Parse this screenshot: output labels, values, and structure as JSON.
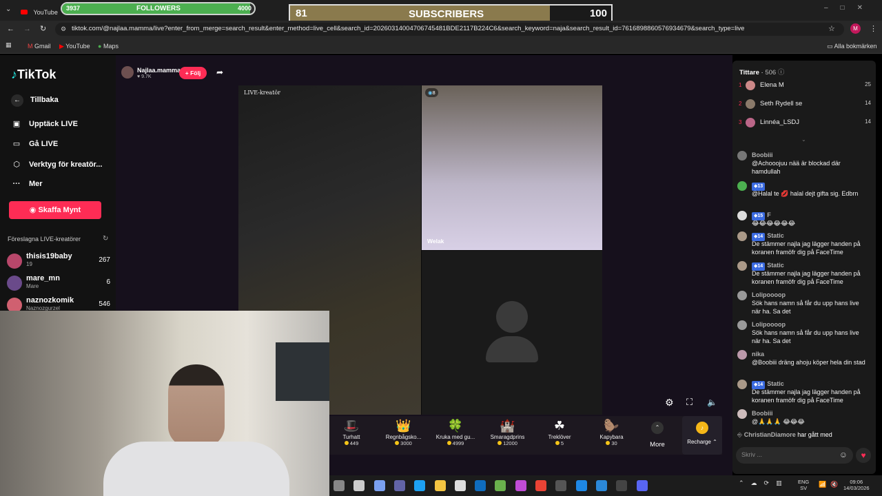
{
  "browser": {
    "tab_title": "YouTube",
    "url": "tiktok.com/@najlaa.mamma/live?enter_from_merge=search_result&enter_method=live_cell&search_id=20260314004706745481BDE2117B224C6&search_keyword=naja&search_result_id=7616898860576934679&search_type=live",
    "bookmarks": [
      "Gmail",
      "YouTube",
      "Maps"
    ],
    "all_bookmarks": "Alla bokmärken",
    "profile_initial": "M"
  },
  "overlay": {
    "followers_label": "FOLLOWERS",
    "followers_current": "3937",
    "followers_goal": "4000",
    "followers_progress": 0.98,
    "subs_label": "SUBSCRIBERS",
    "subs_current": "81",
    "subs_goal": "100",
    "subs_progress": 0.81
  },
  "sidebar": {
    "brand": "TikTok",
    "back": "Tillbaka",
    "items": [
      {
        "label": "Upptäck LIVE",
        "icon": "calendar-icon"
      },
      {
        "label": "Gå LIVE",
        "icon": "camera-icon"
      },
      {
        "label": "Verktyg för kreatör...",
        "icon": "shield-icon"
      },
      {
        "label": "Mer",
        "icon": "more-icon"
      }
    ],
    "coins_button": "Skaffa Mynt",
    "suggested_header": "Föreslagna LIVE-kreatörer",
    "creators": [
      {
        "name": "thisis19baby",
        "sub": "19",
        "count": "267"
      },
      {
        "name": "mare_mn",
        "sub": "Mare",
        "count": "6"
      },
      {
        "name": "naznozkomik",
        "sub": "Naznozgurzel",
        "count": "546"
      }
    ]
  },
  "stream": {
    "host_name": "Najlaa.mamma",
    "host_likes": "9.7K",
    "follow_button": "+ Följ",
    "creator_tag": "LIVE-kreatör",
    "guest_viewers": "8",
    "guest_name": "Welak"
  },
  "gifts": [
    {
      "name": "Turhatt",
      "price": "449",
      "icon": "🎩"
    },
    {
      "name": "Regnbågsko...",
      "price": "3000",
      "icon": "👑"
    },
    {
      "name": "Kruka med gu...",
      "price": "4999",
      "icon": "🍀"
    },
    {
      "name": "Smaragdprins",
      "price": "12000",
      "icon": "🏰"
    },
    {
      "name": "Treklöver",
      "price": "5",
      "icon": "☘"
    },
    {
      "name": "Kapybara",
      "price": "30",
      "icon": "🦫"
    }
  ],
  "gift_more": "Mer",
  "gift_more_big": "More",
  "recharge": "Recharge",
  "viewers": {
    "title": "Tittare",
    "count": "506",
    "list": [
      {
        "rank": "1",
        "name": "Elena M",
        "score": "25"
      },
      {
        "rank": "2",
        "name": "Seth Rydell se",
        "score": "14"
      },
      {
        "rank": "3",
        "name": "Linnéa_LSDJ",
        "score": "14"
      }
    ]
  },
  "chat": [
    {
      "user": "Boobiii",
      "level": "",
      "text": "@Achooojuu nää är blockad där hamdullah"
    },
    {
      "user": "",
      "level": "13",
      "text": "@Halal te 💋 halal dejt gifta sig. Edbrn"
    },
    {
      "user": "F",
      "level": "15",
      "text": "😂😂😂😂😂😂"
    },
    {
      "user": "Static",
      "level": "14",
      "text": "De stämmer najla jag lägger handen på koranen framöfr dig på FaceTime"
    },
    {
      "user": "Static",
      "level": "14",
      "text": "De stämmer najla jag lägger handen på koranen framöfr dig på FaceTime"
    },
    {
      "user": "Lolipoooop",
      "level": "",
      "text": "Sök hans namn så får du upp hans live när ha. Sa det"
    },
    {
      "user": "Lolipoooop",
      "level": "",
      "text": "Sök hans namn så får du upp hans live när ha. Sa det"
    },
    {
      "user": "nika",
      "level": "",
      "text": "@Boobiii dräng ahoju köper hela din stad"
    },
    {
      "user": "Static",
      "level": "14",
      "text": "De stämmer najla jag lägger handen på koranen framöfr dig på FaceTime"
    },
    {
      "user": "Boobiii",
      "level": "",
      "text": "@🙏🙏🙏 😂😂😂"
    }
  ],
  "chat_last": {
    "user": "ChristianDiamore",
    "text": "har gått med"
  },
  "chat_placeholder": "Skriv ...",
  "taskbar": {
    "lang": "ENG",
    "lang2": "SV",
    "time": "09:06",
    "date": "14/03/2026"
  }
}
